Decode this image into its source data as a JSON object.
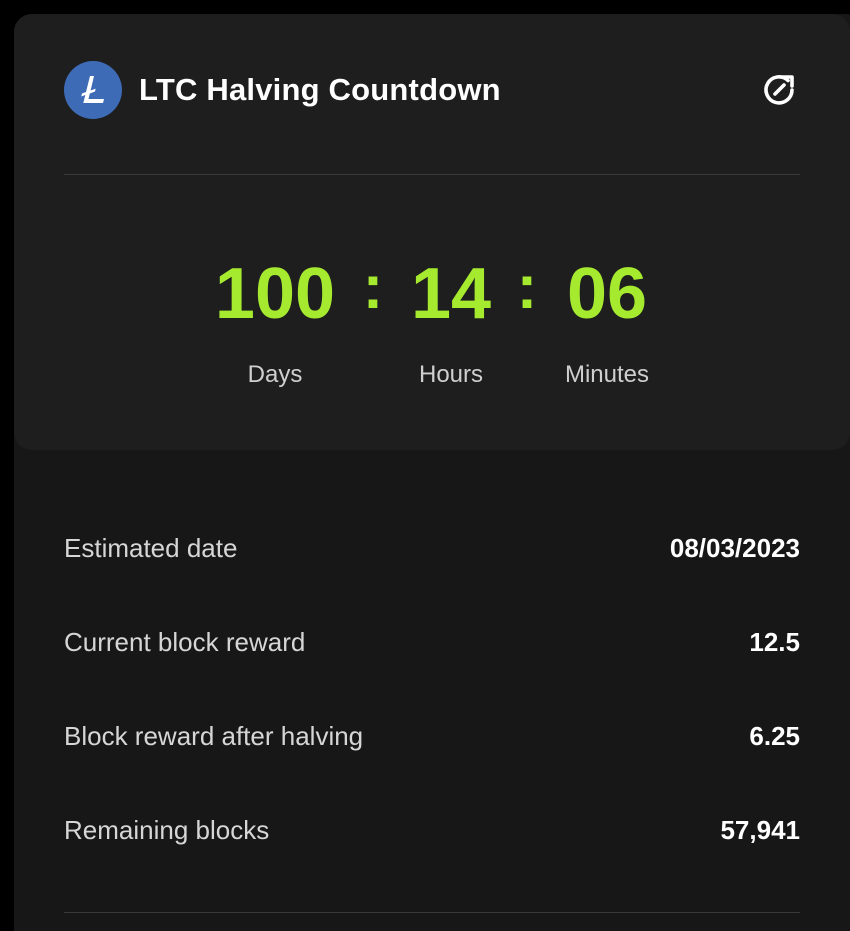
{
  "header": {
    "title": "LTC Halving Countdown",
    "logo_icon": "litecoin-icon",
    "refresh_icon": "refresh-icon",
    "logo_color": "#3d6bb6"
  },
  "countdown": {
    "days": "100",
    "hours": "14",
    "minutes": "06",
    "separator": ":",
    "days_label": "Days",
    "hours_label": "Hours",
    "minutes_label": "Minutes",
    "accent_color": "#a6ea2f"
  },
  "stats": [
    {
      "label": "Estimated date",
      "value": "08/03/2023"
    },
    {
      "label": "Current block reward",
      "value": "12.5"
    },
    {
      "label": "Block reward after halving",
      "value": "6.25"
    },
    {
      "label": "Remaining blocks",
      "value": "57,941"
    }
  ]
}
